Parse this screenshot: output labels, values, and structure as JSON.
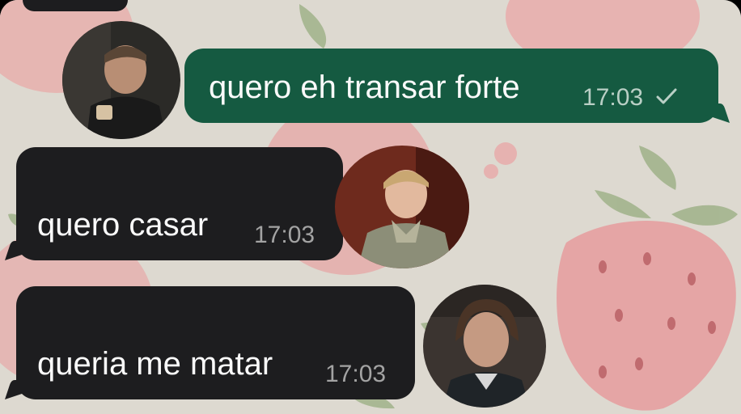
{
  "chat": {
    "messages": [
      {
        "direction": "outgoing",
        "text": "quero eh transar forte",
        "time": "17:03",
        "status_icon": "single-check-icon"
      },
      {
        "direction": "incoming",
        "text": "quero casar",
        "time": "17:03"
      },
      {
        "direction": "incoming",
        "text": "queria me matar",
        "time": "17:03"
      }
    ],
    "avatars": [
      {
        "name": "avatar-1",
        "dominant_color": "#2c2b29"
      },
      {
        "name": "avatar-2",
        "dominant_color": "#6a2419"
      },
      {
        "name": "avatar-3",
        "dominant_color": "#3a322c"
      }
    ]
  },
  "colors": {
    "outgoing_bubble": "#155a41",
    "incoming_bubble": "#1d1d1f",
    "wallpaper": "#ddd9d0",
    "strawberry": "#eaa2a4",
    "leaf": "#9fb189"
  }
}
